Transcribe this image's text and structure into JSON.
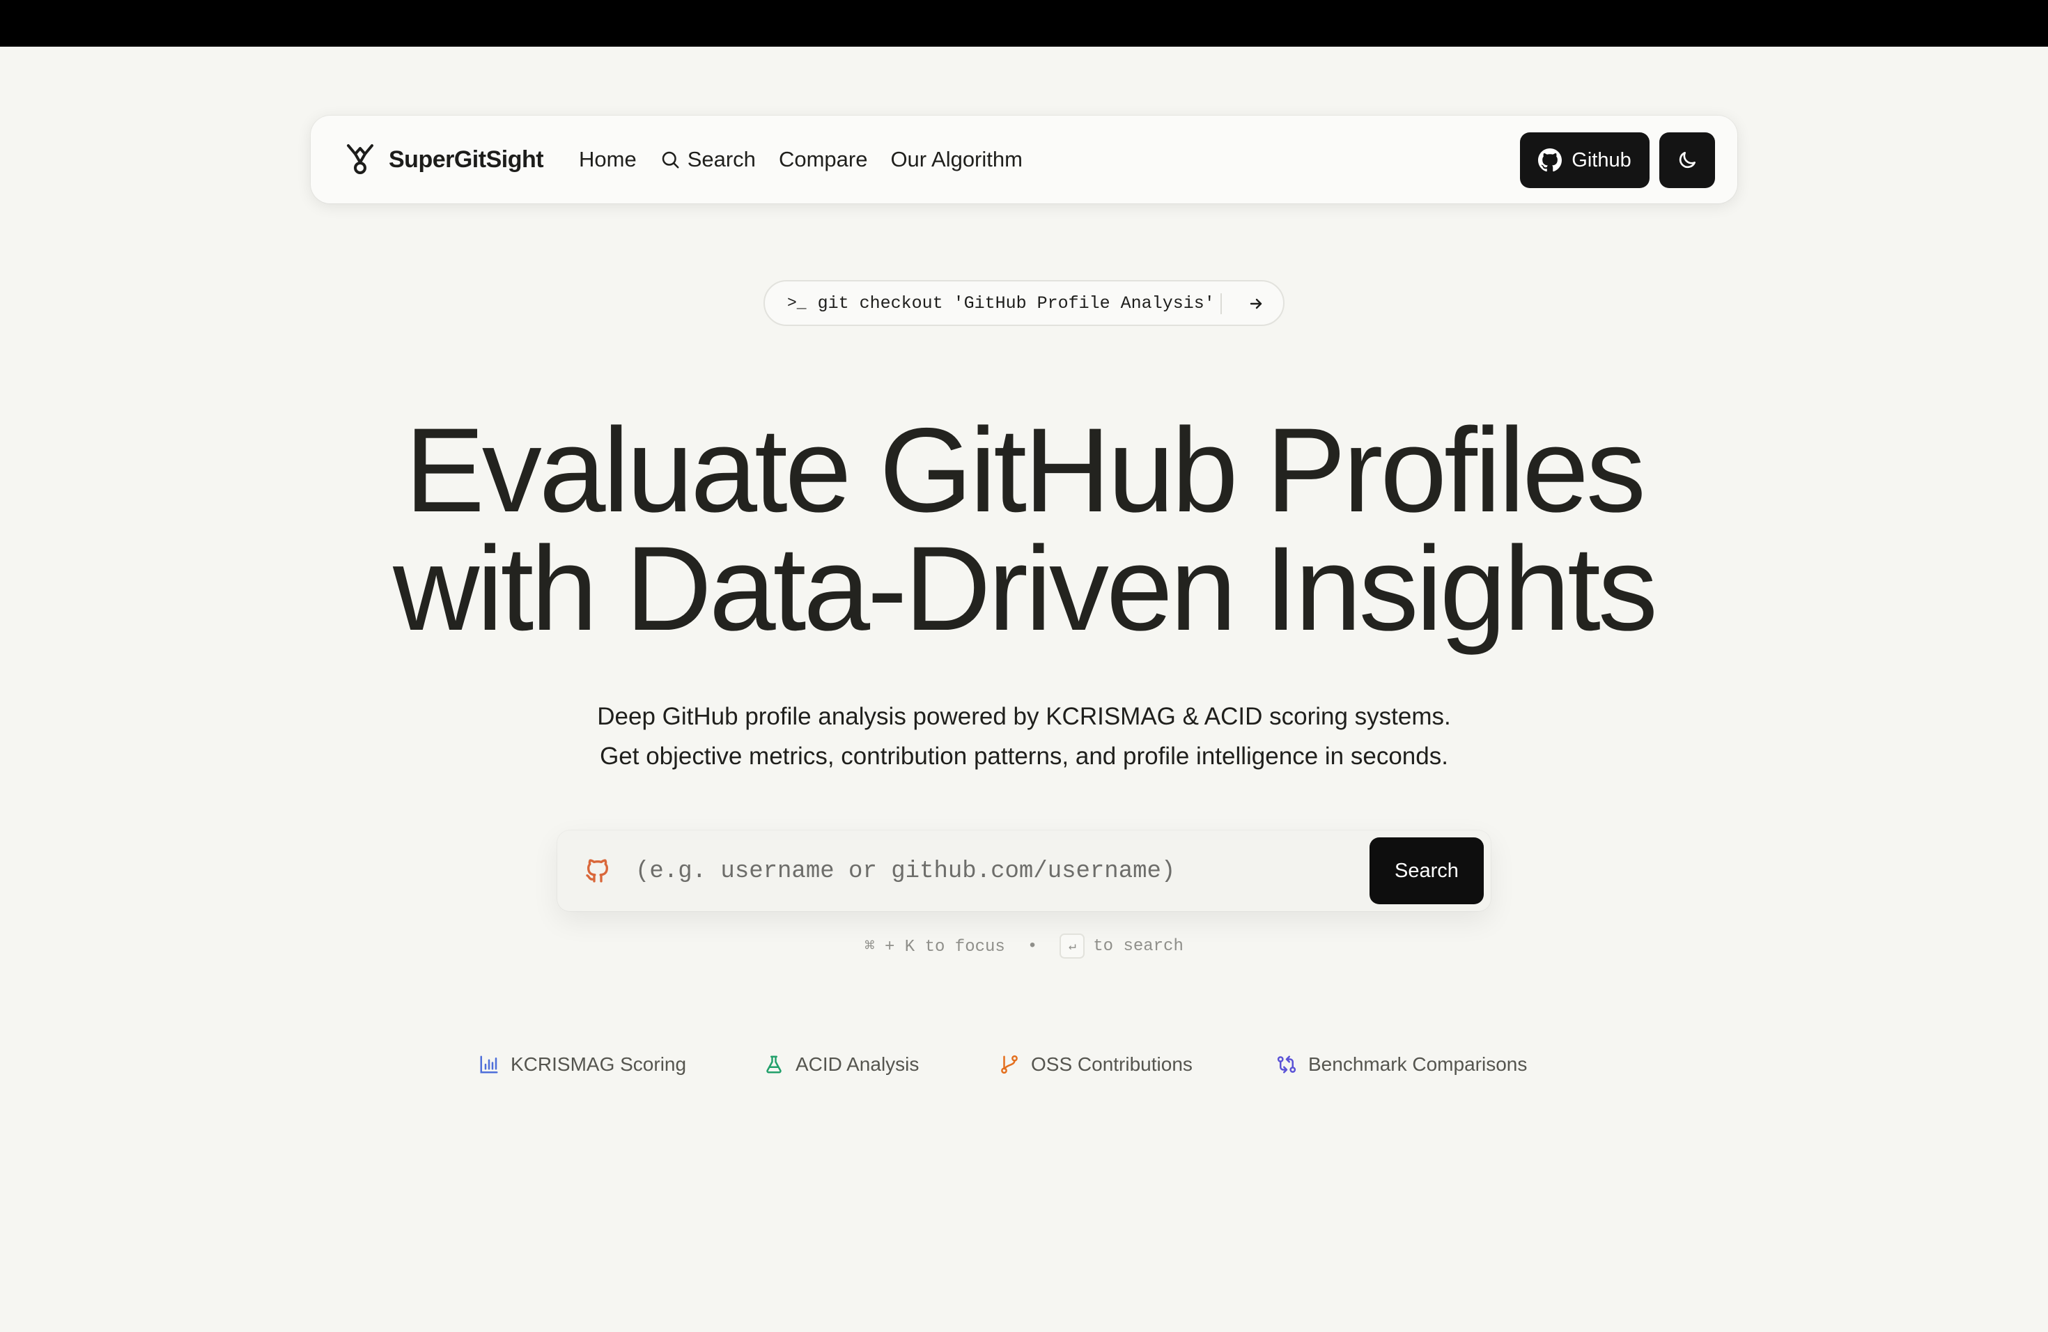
{
  "nav": {
    "brand": "SuperGitSight",
    "links": {
      "home": "Home",
      "search": "Search",
      "compare": "Compare",
      "algorithm": "Our Algorithm"
    },
    "github_label": "Github"
  },
  "pill": {
    "prompt": ">_",
    "command": "git checkout 'GitHub Profile Analysis'"
  },
  "hero": {
    "line1": "Evaluate GitHub Profiles",
    "line2": "with Data-Driven Insights",
    "sub1": "Deep GitHub profile analysis powered by KCRISMAG & ACID scoring systems.",
    "sub2": "Get objective metrics, contribution patterns, and profile intelligence in seconds."
  },
  "search": {
    "placeholder": "(e.g. username or github.com/username)",
    "button": "Search",
    "hint_focus": "⌘ + K to focus",
    "hint_sep": "•",
    "hint_enter_key": "↵",
    "hint_search": "to search"
  },
  "features": [
    {
      "label": "KCRISMAG Scoring",
      "icon": "bar-chart-icon",
      "color": "#4f6fd9"
    },
    {
      "label": "ACID Analysis",
      "icon": "flask-icon",
      "color": "#22a06b"
    },
    {
      "label": "OSS Contributions",
      "icon": "git-branch-icon",
      "color": "#e36f1e"
    },
    {
      "label": "Benchmark Comparisons",
      "icon": "git-compare-icon",
      "color": "#5a52d6"
    }
  ],
  "colors": {
    "background": "#f6f6f2",
    "dark": "#141414",
    "github_accent": "#d9673a"
  }
}
